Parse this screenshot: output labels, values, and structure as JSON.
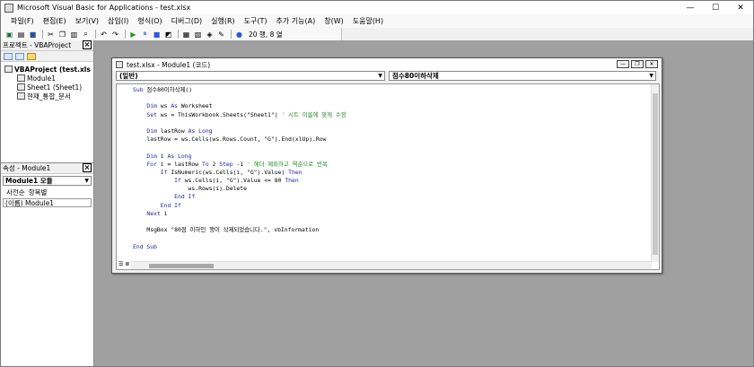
{
  "window": {
    "title": "Microsoft Visual Basic for Applications - test.xlsx",
    "controls": [
      "—",
      "☐",
      "✕"
    ]
  },
  "menu": [
    "파일(F)",
    "편집(E)",
    "보기(V)",
    "삽입(I)",
    "형식(O)",
    "디버그(D)",
    "실행(R)",
    "도구(T)",
    "추가 기능(A)",
    "창(W)",
    "도움말(H)"
  ],
  "toolbar": {
    "position": "20 행, 8 열"
  },
  "project_panel": {
    "title": "프로젝트 - VBAProject",
    "root": "VBAProject (test.xls",
    "items": [
      "Module1",
      "Sheet1 (Sheet1)",
      "현재_통합_문서"
    ]
  },
  "props_panel": {
    "title": "속성 - Module1",
    "selector": "Module1 모듈",
    "tabs": [
      "사전순",
      "항목별"
    ],
    "row": "(이름) Module1"
  },
  "code_window": {
    "title": "test.xlsx - Module1 (코드)",
    "object_combo": "(일반)",
    "proc_combo": "점수80이하삭제",
    "view_icons": "☰ ≣"
  },
  "code_lines": [
    [
      [
        "kw",
        "Sub"
      ],
      [
        "t",
        " 점수80이하삭제()"
      ]
    ],
    [
      [
        "t",
        ""
      ]
    ],
    [
      [
        "t",
        "    "
      ],
      [
        "kw",
        "Dim"
      ],
      [
        "t",
        " ws "
      ],
      [
        "kw",
        "As"
      ],
      [
        "t",
        " Worksheet"
      ]
    ],
    [
      [
        "t",
        "    "
      ],
      [
        "kw",
        "Set"
      ],
      [
        "t",
        " ws = ThisWorkbook.Sheets(\"Sheet1\") "
      ],
      [
        "cm",
        "' 시트 이름에 맞게 수정"
      ]
    ],
    [
      [
        "t",
        ""
      ]
    ],
    [
      [
        "t",
        "    "
      ],
      [
        "kw",
        "Dim"
      ],
      [
        "t",
        " lastRow "
      ],
      [
        "kw",
        "As Long"
      ]
    ],
    [
      [
        "t",
        "    lastRow = ws.Cells(ws.Rows.Count, \"G\").End(xlUp).Row"
      ]
    ],
    [
      [
        "t",
        ""
      ]
    ],
    [
      [
        "t",
        "    "
      ],
      [
        "kw",
        "Dim"
      ],
      [
        "t",
        " i "
      ],
      [
        "kw",
        "As Long"
      ]
    ],
    [
      [
        "t",
        "    "
      ],
      [
        "kw",
        "For"
      ],
      [
        "t",
        " i = lastRow "
      ],
      [
        "kw",
        "To"
      ],
      [
        "t",
        " 2 "
      ],
      [
        "kw",
        "Step"
      ],
      [
        "t",
        " -1 "
      ],
      [
        "cm",
        "' 헤더 제외하고 역순으로 반복"
      ]
    ],
    [
      [
        "t",
        "        "
      ],
      [
        "kw",
        "If"
      ],
      [
        "t",
        " IsNumeric(ws.Cells(i, \"G\").Value) "
      ],
      [
        "kw",
        "Then"
      ]
    ],
    [
      [
        "t",
        "            "
      ],
      [
        "kw",
        "If"
      ],
      [
        "t",
        " ws.Cells(i, \"G\").Value <= 80 "
      ],
      [
        "kw",
        "Then"
      ]
    ],
    [
      [
        "t",
        "                ws.Rows(i).Delete"
      ]
    ],
    [
      [
        "t",
        "            "
      ],
      [
        "kw",
        "End If"
      ]
    ],
    [
      [
        "t",
        "        "
      ],
      [
        "kw",
        "End If"
      ]
    ],
    [
      [
        "t",
        "    "
      ],
      [
        "kw",
        "Next"
      ],
      [
        "t",
        " i"
      ]
    ],
    [
      [
        "t",
        ""
      ]
    ],
    [
      [
        "t",
        "    MsgBox \"80점 이하인 행이 삭제되었습니다.\", vbInformation"
      ]
    ],
    [
      [
        "t",
        ""
      ]
    ],
    [
      [
        "kw",
        "End Sub"
      ]
    ]
  ]
}
